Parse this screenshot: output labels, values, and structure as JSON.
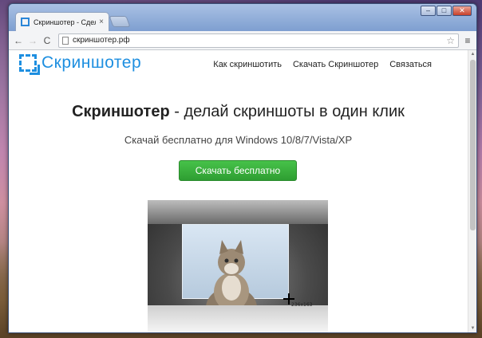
{
  "browser": {
    "tab_title": "Скриншотер - Сделать ск",
    "tab_close": "×",
    "window_controls": {
      "minimize": "–",
      "maximize": "□",
      "close": "✕"
    },
    "nav": {
      "back_icon": "←",
      "forward_icon": "→",
      "reload_icon": "C"
    },
    "url": "скриншотер.рф",
    "star_icon": "☆",
    "menu_icon": "≡"
  },
  "site": {
    "logo_text": "Скриншотер",
    "nav_items": [
      "Как скриншотить",
      "Скачать Скриншотер",
      "Связаться"
    ],
    "hero": {
      "title_brand": "Скриншотер",
      "title_rest": " - делай скриншоты в один клик",
      "subtitle": "Скачай бесплатно для Windows 10/8/7/Vista/XP",
      "download_button": "Скачать бесплатно"
    },
    "demo": {
      "selection_size": "236x163"
    }
  },
  "colors": {
    "brand_blue": "#1e8fe0",
    "button_green": "#3bb23e"
  },
  "icons": {
    "logo": "dashed-square-icon",
    "tab_favicon": "dashed-square-icon",
    "star": "star-icon",
    "menu": "hamburger-icon"
  }
}
